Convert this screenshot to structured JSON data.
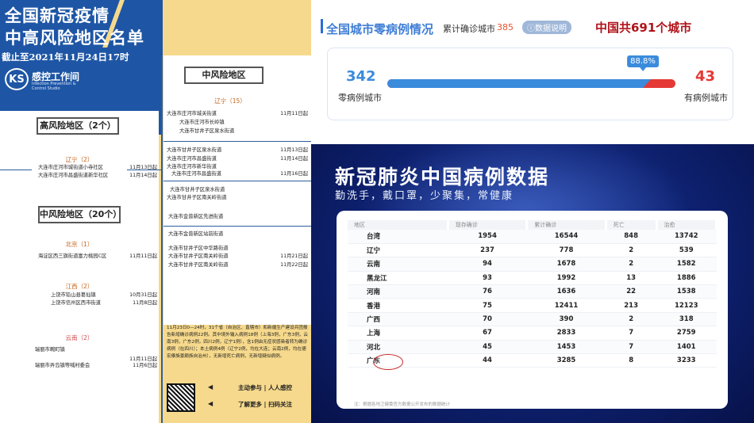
{
  "poster": {
    "title_line1": "全国新冠疫情",
    "title_line2": "中高风险地区名单",
    "date": "截止至2021年11月24日17时",
    "logo_letters": "KS",
    "logo_name": "感控工作间",
    "logo_sub": "Infection Prevention & Control Studio",
    "high_risk_header": "高风险地区（2个）",
    "mid_risk_header_left": "中风险地区（20个）",
    "mid_risk_header_right": "中风险地区",
    "left_groups": [
      {
        "province": "辽宁（2）",
        "entries": [
          {
            "place": "大连市庄河市城街道小寺社区",
            "date": "11月13日起"
          },
          {
            "place": "大连市庄河市昌盛街道新华社区",
            "date": "11月14日起"
          }
        ]
      },
      {
        "province": "北京（1）",
        "entries": [
          {
            "place": "海淀区西三旗街道富力桃园C区",
            "date": "11月11日起"
          }
        ]
      },
      {
        "province": "江西（2）",
        "entries": [
          {
            "place": "上饶市铅山县葛仙镇",
            "date": "10月31日起"
          },
          {
            "place": "上饶市信州区西市街道",
            "date": "11月8日起"
          }
        ]
      },
      {
        "province": "云南（2）",
        "entries": [
          {
            "place": "瑞丽市畹町镇",
            "date": "11月11日起"
          },
          {
            "place": "瑞丽市弄岛镇等喊村委会",
            "date": "11月6日起"
          }
        ]
      }
    ],
    "right_province": "辽宁（15）",
    "right_entries": [
      {
        "place": "大连市庄河市城关街道",
        "date": "11月11日起"
      },
      {
        "place": "大连市庄河市长岭镇",
        "date": ""
      },
      {
        "place": "大连市甘井子区泉水街道",
        "date": ""
      },
      {
        "place": "大连市甘井子区泉水街道",
        "date": "11月13日起"
      },
      {
        "place": "大连市庄河市昌盛街道",
        "date": "11月14日起"
      },
      {
        "place": "大连市庄河市新华街道",
        "date": ""
      },
      {
        "place": "大连市庄河市昌盛街道",
        "date": "11月16日起"
      },
      {
        "place": "大连市甘井子区泉水街道",
        "date": ""
      },
      {
        "place": "大连市甘井子区南关岭街道",
        "date": ""
      },
      {
        "place": "大连市金普新区先进街道",
        "date": ""
      },
      {
        "place": "大连市金普新区站前街道",
        "date": ""
      },
      {
        "place": "大连市甘井子区中华路街道",
        "date": ""
      },
      {
        "place": "大连市甘井子区南关岭街道",
        "date": "11月21日起"
      },
      {
        "place": "大连市甘井子区南关岭街道",
        "date": "11月22日起"
      }
    ],
    "notice": "11月23日0—24时，31个省（自治区、直辖市）和新疆生产建设兵团报告新增确诊病例22例。其中境外输入病例18例（上海3例，广东3例，云南3例，广东2例，四川2例，辽宁1例），含1例由无症状感染者转为确诊病例（在四川）；本土病例4例（辽宁2例，均在大连；云南2例，均在德宏傣族景颇族自治州），无新增死亡病例，无新增疑似病例。",
    "action1": "主动参与 | 人人感控",
    "action2": "了解更多 | 扫码关注"
  },
  "stats": {
    "title": "全国城市零病例情况",
    "cumulative_label": "累计确诊城市",
    "cumulative_value": "385",
    "info_button": "ⓘ数据说明",
    "country_total": "中国共691个城市",
    "zero_count": "342",
    "zero_label": "零病例城市",
    "has_count": "43",
    "has_label": "有病例城市",
    "percent_label": "88.8%",
    "zero_fraction": 0.888
  },
  "dark_panel": {
    "heading": "新冠肺炎中国病例数据",
    "subheading": "勤洗手，戴口罩，少聚集，常健康",
    "columns": [
      "地区",
      "现存确诊",
      "累计确诊",
      "死亡",
      "治愈"
    ],
    "rows": [
      {
        "region": "台湾",
        "current": "1954",
        "total": "16544",
        "deaths": "848",
        "cured": "13742"
      },
      {
        "region": "辽宁",
        "current": "237",
        "total": "778",
        "deaths": "2",
        "cured": "539"
      },
      {
        "region": "云南",
        "current": "94",
        "total": "1678",
        "deaths": "2",
        "cured": "1582"
      },
      {
        "region": "黑龙江",
        "current": "93",
        "total": "1992",
        "deaths": "13",
        "cured": "1886"
      },
      {
        "region": "河南",
        "current": "76",
        "total": "1636",
        "deaths": "22",
        "cured": "1538"
      },
      {
        "region": "香港",
        "current": "75",
        "total": "12411",
        "deaths": "213",
        "cured": "12123"
      },
      {
        "region": "广西",
        "current": "70",
        "total": "390",
        "deaths": "2",
        "cured": "318"
      },
      {
        "region": "上海",
        "current": "67",
        "total": "2833",
        "deaths": "7",
        "cured": "2759"
      },
      {
        "region": "河北",
        "current": "45",
        "total": "1453",
        "deaths": "7",
        "cured": "1401"
      },
      {
        "region": "广东",
        "current": "44",
        "total": "3285",
        "deaths": "8",
        "cured": "3233"
      }
    ],
    "footnote": "注：根据各地卫健委官方数据公开发布的数据统计"
  }
}
